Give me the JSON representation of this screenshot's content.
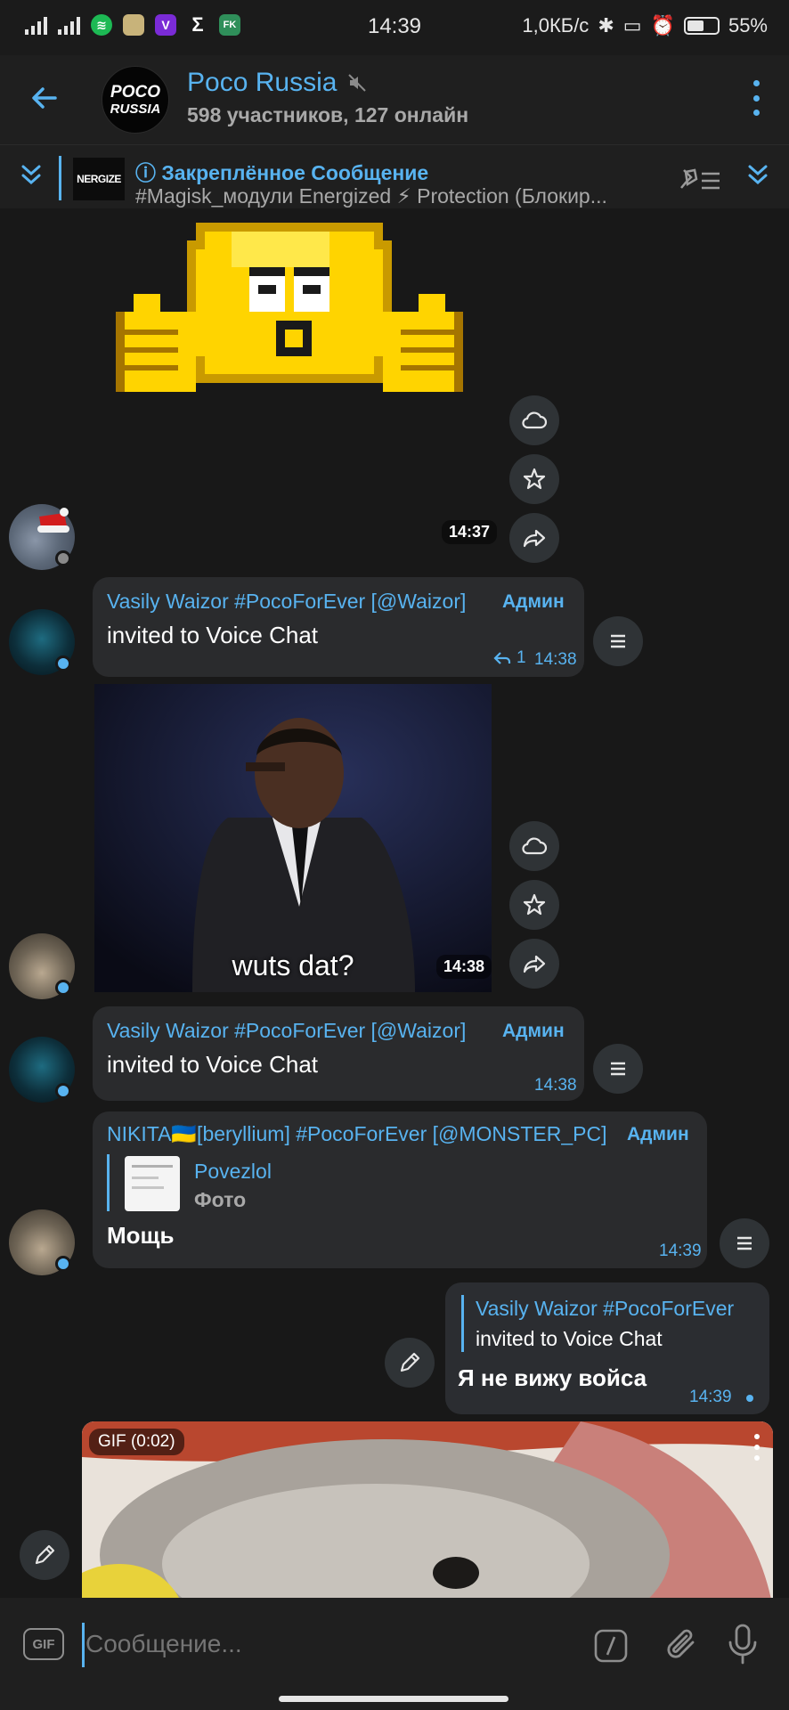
{
  "status_bar": {
    "time": "14:39",
    "net_speed": "1,0КБ/с",
    "battery": "55%",
    "sigma": "Σ",
    "vapp": "V",
    "fk": "FK"
  },
  "header": {
    "title": "Poco Russia",
    "subtitle": "598 участников, 127 онлайн",
    "avatar_line1": "POCO",
    "avatar_line2": "RUSSIA"
  },
  "pinned": {
    "title": "Закреплённое Сообщение",
    "text": "#Magisk_модули Energized ⚡ Protection (Блокир...",
    "thumb": "NERGIZE"
  },
  "messages": [
    {
      "type": "sticker",
      "time": "14:37"
    },
    {
      "type": "service",
      "sender": "Vasily Waizor #PocoForEver [@Waizor]",
      "badge": "Админ",
      "text": "invited to Voice Chat",
      "replies": "1",
      "time": "14:38"
    },
    {
      "type": "gif",
      "caption": "wuts dat?",
      "time": "14:38"
    },
    {
      "type": "service",
      "sender": "Vasily Waizor #PocoForEver [@Waizor]",
      "badge": "Админ",
      "text": "invited to Voice Chat",
      "time": "14:38"
    },
    {
      "type": "reply",
      "sender": "NIKITA🇺🇦[beryllium] #PocoForEver [@MONSTER_PC]",
      "badge": "Админ",
      "reply_name": "Povezlol",
      "reply_text": "Фото",
      "text": "Мощь",
      "time": "14:39"
    },
    {
      "type": "outgoing",
      "reply_name": "Vasily Waizor #PocoForEver",
      "reply_text": "invited to Voice Chat",
      "text": "Я не вижу войса",
      "time": "14:39"
    },
    {
      "type": "gif",
      "label": "GIF (0:02)"
    }
  ],
  "composer": {
    "gif_label": "GIF",
    "placeholder": "Сообщение..."
  }
}
